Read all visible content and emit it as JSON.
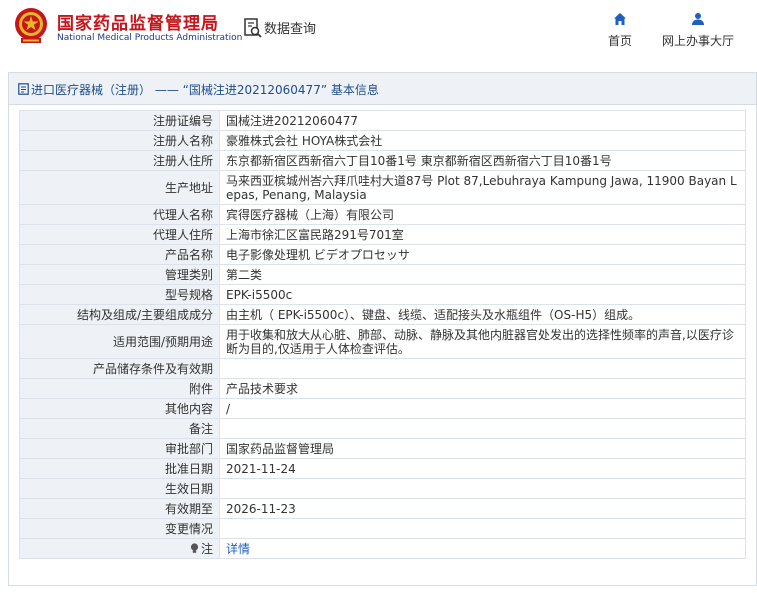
{
  "header": {
    "brand_cn": "国家药品监督管理局",
    "brand_en": "National Medical Products Administration",
    "query_label": "数据查询",
    "nav": [
      {
        "label": "首页",
        "icon": "home-icon"
      },
      {
        "label": "网上办事大厅",
        "icon": "user-icon"
      }
    ]
  },
  "panel": {
    "title": "进口医疗器械（注册） —— “国械注进20212060477” 基本信息"
  },
  "rows": [
    {
      "label": "注册证编号",
      "value": "国械注进20212060477"
    },
    {
      "label": "注册人名称",
      "value": "豪雅株式会社 HOYA株式会社"
    },
    {
      "label": "注册人住所",
      "value": "东京都新宿区西新宿六丁目10番1号 東京都新宿区西新宿六丁目10番1号"
    },
    {
      "label": "生产地址",
      "value": "马来西亚槟城州峇六拜爪哇村大道87号 Plot 87,Lebuhraya Kampung Jawa, 11900 Bayan Lepas, Penang, Malaysia"
    },
    {
      "label": "代理人名称",
      "value": "宾得医疗器械（上海）有限公司"
    },
    {
      "label": "代理人住所",
      "value": "上海市徐汇区富民路291号701室"
    },
    {
      "label": "产品名称",
      "value": "电子影像处理机 ビデオプロセッサ"
    },
    {
      "label": "管理类别",
      "value": "第二类"
    },
    {
      "label": "型号规格",
      "value": "EPK-i5500c"
    },
    {
      "label": "结构及组成/主要组成成分",
      "value": "由主机（ EPK-i5500c）、键盘、线缆、适配接头及水瓶组件（OS-H5）组成。"
    },
    {
      "label": "适用范围/预期用途",
      "value": "用于收集和放大从心脏、肺部、动脉、静脉及其他内脏器官处发出的选择性频率的声音,以医疗诊断为目的,仅适用于人体检查评估。"
    },
    {
      "label": "产品储存条件及有效期",
      "value": ""
    },
    {
      "label": "附件",
      "value": "产品技术要求"
    },
    {
      "label": "其他内容",
      "value": "/"
    },
    {
      "label": "备注",
      "value": ""
    },
    {
      "label": "审批部门",
      "value": "国家药品监督管理局"
    },
    {
      "label": "批准日期",
      "value": "2021-11-24"
    },
    {
      "label": "生效日期",
      "value": ""
    },
    {
      "label": "有效期至",
      "value": "2026-11-23"
    },
    {
      "label": "变更情况",
      "value": ""
    },
    {
      "label": "注",
      "value": "详情"
    }
  ],
  "colors": {
    "brand_red": "#c4161c",
    "brand_blue": "#1e3a8a",
    "title_blue": "#1f4d8c",
    "link_blue": "#1f5fbf",
    "label_bg": "#eef1f5"
  }
}
